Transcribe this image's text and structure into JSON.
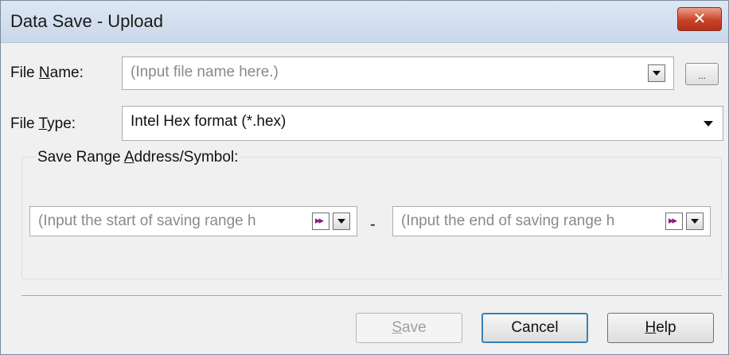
{
  "window": {
    "title": "Data Save - Upload",
    "close_label": "✕"
  },
  "file_name": {
    "label_prefix": "File ",
    "label_accel": "N",
    "label_suffix": "ame:",
    "placeholder": "(Input file name here.)",
    "browse_label": "..."
  },
  "file_type": {
    "label_prefix": "File ",
    "label_accel": "T",
    "label_suffix": "ype:",
    "value": "Intel Hex format (*.hex)"
  },
  "range": {
    "group_prefix": "Save Range ",
    "group_accel": "A",
    "group_suffix": "ddress/Symbol:",
    "start_placeholder": "(Input the start of saving range h",
    "separator": "-",
    "end_placeholder": "(Input the end of saving range h"
  },
  "buttons": {
    "save_accel": "S",
    "save_rest": "ave",
    "cancel": "Cancel",
    "help_accel": "H",
    "help_rest": "elp"
  },
  "icons": {
    "symbol_icon": "▸▸"
  }
}
